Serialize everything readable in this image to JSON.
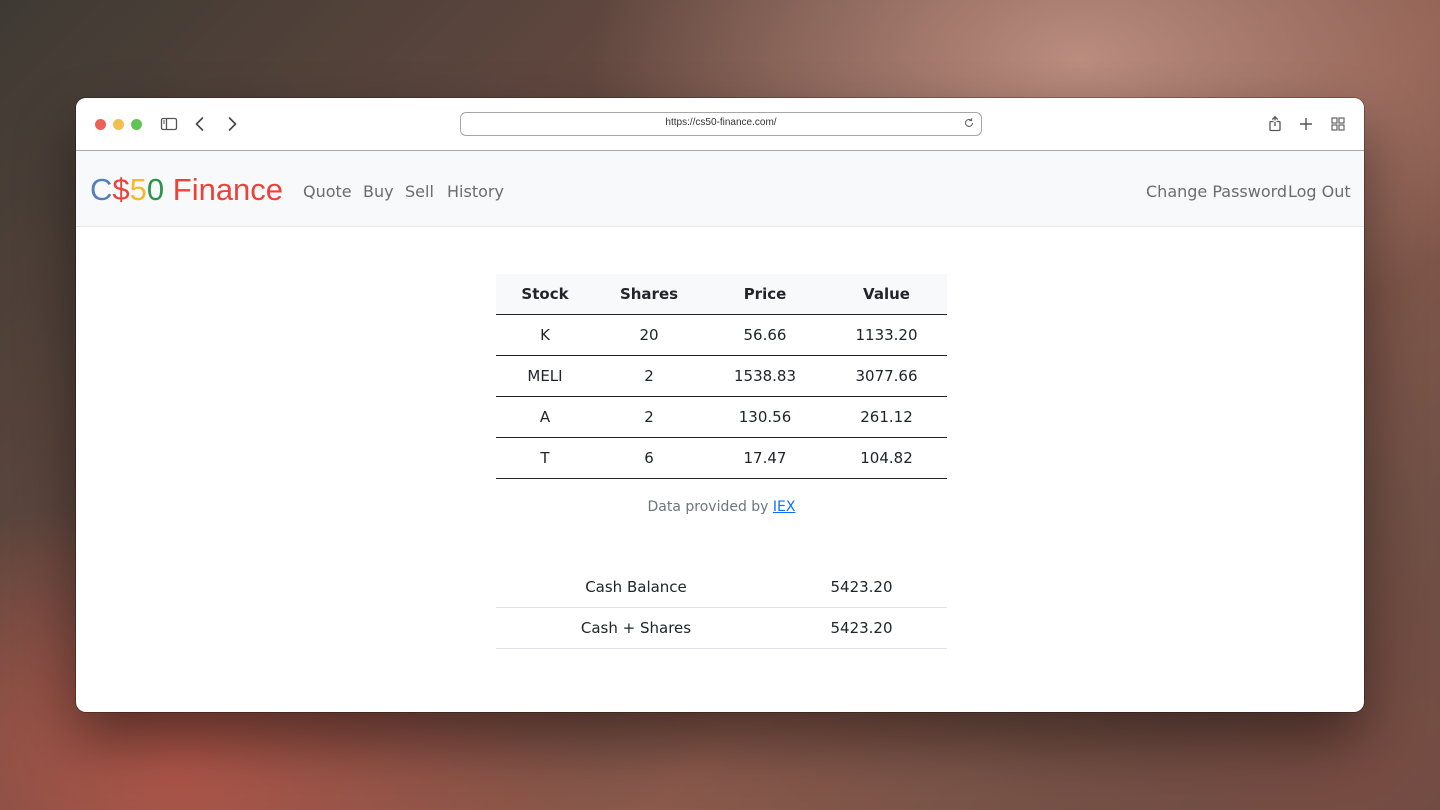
{
  "browser": {
    "url": "https://cs50-finance.com/"
  },
  "brand": {
    "c": "C",
    "dollar": "$",
    "five": "5",
    "zero": "0",
    "finance": " Finance"
  },
  "nav": {
    "left": [
      "Quote",
      "Buy",
      "Sell",
      "History"
    ],
    "right": [
      "Change Password",
      "Log Out"
    ]
  },
  "portfolio": {
    "headers": [
      "Stock",
      "Shares",
      "Price",
      "Value"
    ],
    "rows": [
      [
        "K",
        "20",
        "56.66",
        "1133.20"
      ],
      [
        "MELI",
        "2",
        "1538.83",
        "3077.66"
      ],
      [
        "A",
        "2",
        "130.56",
        "261.12"
      ],
      [
        "T",
        "6",
        "17.47",
        "104.82"
      ]
    ]
  },
  "footnote": {
    "prefix": "Data provided by",
    "link": "IEX"
  },
  "summary": {
    "rows": [
      [
        "Cash Balance",
        "5423.20"
      ],
      [
        "Cash + Shares",
        "5423.20"
      ]
    ]
  },
  "colors": {
    "brand_blue": "#537fbe",
    "brand_red": "#ea433b",
    "brand_yellow": "#f5b82e",
    "brand_green": "#2e944b",
    "link": "#0d6efd"
  }
}
